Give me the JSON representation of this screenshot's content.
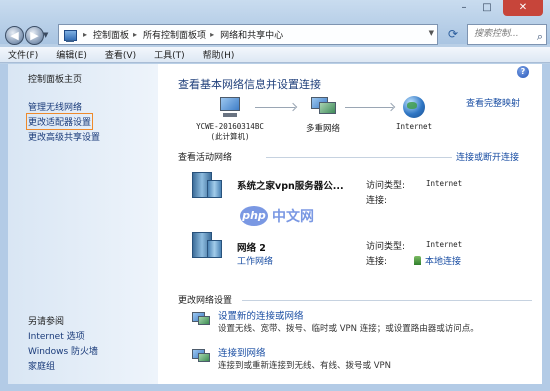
{
  "window": {
    "controls": {
      "minimize": "–",
      "maximize": "□",
      "close": "✕"
    }
  },
  "nav": {
    "back_glyph": "◀",
    "forward_glyph": "▶",
    "breadcrumbs": [
      "控制面板",
      "所有控制面板项",
      "网络和共享中心"
    ],
    "search_placeholder": "搜索控制...",
    "icons": {
      "address": "control-panel-icon",
      "refresh": "refresh-icon",
      "search": "search-icon"
    }
  },
  "menu": [
    "文件(F)",
    "编辑(E)",
    "查看(V)",
    "工具(T)",
    "帮助(H)"
  ],
  "sidebar": {
    "home": "控制面板主页",
    "links": [
      "管理无线网络",
      "更改适配器设置",
      "更改高级共享设置"
    ],
    "see_also_heading": "另请参阅",
    "see_also": [
      "Internet 选项",
      "Windows 防火墙",
      "家庭组"
    ]
  },
  "main": {
    "help_glyph": "?",
    "title": "查看基本网络信息并设置连接",
    "full_map_link": "查看完整映射",
    "map": {
      "nodes": [
        {
          "label_line1": "YCWE-20160314BC",
          "label_line2": "(此计算机)",
          "icon": "computer-icon"
        },
        {
          "label_line1": "多重网络",
          "label_line2": "",
          "icon": "multiple-networks-icon"
        },
        {
          "label_line1": "Internet",
          "label_line2": "",
          "icon": "internet-globe-icon"
        }
      ]
    },
    "active": {
      "title": "查看活动网络",
      "connect_link": "连接或断开连接",
      "networks": [
        {
          "name": "系统之家vpn服务器公...",
          "type": "",
          "access_label": "访问类型:",
          "access_value": "Internet",
          "conn_label": "连接:",
          "conn_value": ""
        },
        {
          "name": "网络  2",
          "type": "工作网络",
          "access_label": "访问类型:",
          "access_value": "Internet",
          "conn_label": "连接:",
          "conn_value": "本地连接"
        }
      ]
    },
    "change": {
      "title": "更改网络设置",
      "tasks": [
        {
          "link": "设置新的连接或网络",
          "desc": "设置无线、宽带、拨号、临时或 VPN 连接；或设置路由器或访问点。"
        },
        {
          "link": "连接到网络",
          "desc": "连接到或重新连接到无线、有线、拨号或 VPN"
        }
      ]
    }
  },
  "watermark": {
    "logo": "php",
    "text": "中文网"
  }
}
